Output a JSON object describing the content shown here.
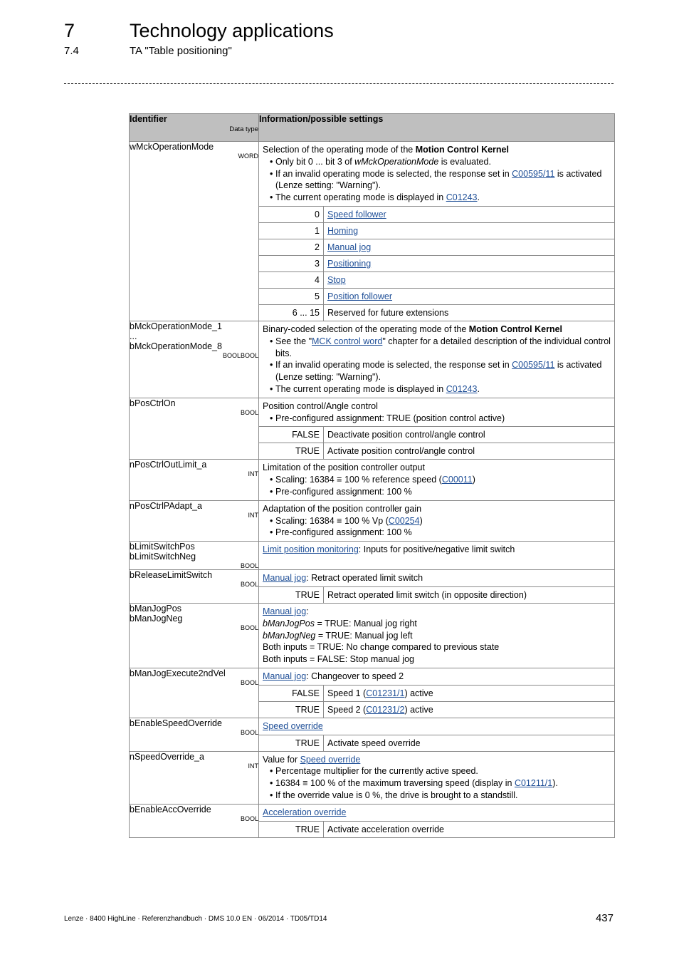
{
  "header": {
    "chapter_number": "7",
    "chapter_title": "Technology applications",
    "section_number": "7.4",
    "section_title": "TA \"Table positioning\""
  },
  "table": {
    "col_identifier": "Identifier",
    "col_datatype": "Data type",
    "col_info": "Information/possible settings",
    "rows": [
      {
        "id": "wMckOperationMode",
        "type": "WORD",
        "desc_pre": "Selection of the operating mode of the ",
        "desc_bold": "Motion Control Kernel",
        "b1_pre": "Only bit 0 ... bit 3 of ",
        "b1_ital": "wMckOperationMode",
        "b1_post": " is evaluated.",
        "b2_pre": "If an invalid operating mode is selected, the response set in ",
        "b2_link": "C00595/11",
        "b2_post": " is activated (Lenze setting: \"Warning\").",
        "b3_pre": "The current operating mode is displayed in ",
        "b3_link": "C01243",
        "b3_post": ".",
        "values": [
          {
            "v": "0",
            "t": "Speed follower"
          },
          {
            "v": "1",
            "t": "Homing"
          },
          {
            "v": "2",
            "t": "Manual jog"
          },
          {
            "v": "3",
            "t": "Positioning"
          },
          {
            "v": "4",
            "t": "Stop"
          },
          {
            "v": "5",
            "t": "Position follower"
          },
          {
            "v": "6 ... 15",
            "t": "Reserved for future extensions"
          }
        ]
      },
      {
        "id1": "bMckOperationMode_1",
        "id_dots": "...",
        "id2": "bMckOperationMode_8",
        "type": "BOOLBOOL",
        "desc_pre": "Binary-coded selection of the operating mode of the ",
        "desc_bold": "Motion Control Kernel",
        "b1_pre": "See the \"",
        "b1_link": "MCK control word",
        "b1_post": "\" chapter for a detailed description of the individual control bits.",
        "b2_pre": "If an invalid operating mode is selected, the response set in ",
        "b2_link": "C00595/11",
        "b2_post": " is activated (Lenze setting: \"Warning\").",
        "b3_pre": "The current operating mode is displayed in ",
        "b3_link": "C01243",
        "b3_post": "."
      },
      {
        "id": "bPosCtrlOn",
        "type": "BOOL",
        "desc": "Position control/Angle control",
        "b1": "Pre-configured assignment: TRUE (position control active)",
        "values": [
          {
            "v": "FALSE",
            "t": "Deactivate position control/angle control"
          },
          {
            "v": "TRUE",
            "t": "Activate position control/angle control"
          }
        ]
      },
      {
        "id": "nPosCtrlOutLimit_a",
        "type": "INT",
        "desc": "Limitation of the position controller output",
        "b1_pre": "Scaling: 16384 ≡ 100 % reference speed (",
        "b1_link": "C00011",
        "b1_post": ")",
        "b2": "Pre-configured assignment: 100 %"
      },
      {
        "id": "nPosCtrlPAdapt_a",
        "type": "INT",
        "desc": "Adaptation of the position controller gain",
        "b1_pre": "Scaling: 16384 ≡ 100 % Vp (",
        "b1_link": "C00254",
        "b1_post": ")",
        "b2": "Pre-configured assignment: 100 %"
      },
      {
        "id1": "bLimitSwitchPos",
        "id2": "bLimitSwitchNeg",
        "type": "BOOL",
        "desc_link": "Limit position monitoring",
        "desc_post": ": Inputs for positive/negative limit switch"
      },
      {
        "id": "bReleaseLimitSwitch",
        "type": "BOOL",
        "desc_link": "Manual jog",
        "desc_post": ": Retract operated limit switch",
        "values": [
          {
            "v": "TRUE",
            "t": "Retract operated limit switch (in opposite direction)"
          }
        ]
      },
      {
        "id1": "bManJogPos",
        "id2": "bManJogNeg",
        "type": "BOOL",
        "desc_link": "Manual jog",
        "desc_post": ":",
        "l1_ital": "bManJogPos",
        "l1_post": " = TRUE: Manual jog right",
        "l2_ital": "bManJogNeg",
        "l2_post": " = TRUE: Manual jog left",
        "l3": "Both inputs = TRUE: No change compared to previous state",
        "l4": "Both inputs = FALSE: Stop manual jog"
      },
      {
        "id": "bManJogExecute2ndVel",
        "type": "BOOL",
        "desc_link": "Manual jog",
        "desc_post": ": Changeover to speed 2",
        "values": [
          {
            "v": "FALSE",
            "t_pre": "Speed 1 (",
            "t_link": "C01231/1",
            "t_post": ") active"
          },
          {
            "v": "TRUE",
            "t_pre": "Speed 2 (",
            "t_link": "C01231/2",
            "t_post": ") active"
          }
        ]
      },
      {
        "id": "bEnableSpeedOverride",
        "type": "BOOL",
        "desc_link": "Speed override",
        "values": [
          {
            "v": "TRUE",
            "t": "Activate speed override"
          }
        ]
      },
      {
        "id": "nSpeedOverride_a",
        "type": "INT",
        "desc_pre": "Value for ",
        "desc_link": "Speed override",
        "b1": "Percentage multiplier for the currently active speed.",
        "b2_pre": "16384 ≡ 100 % of the maximum traversing speed (display in ",
        "b2_link": "C01211/1",
        "b2_post": ").",
        "b3": "If the override value is 0 %, the drive is brought to a standstill."
      },
      {
        "id": "bEnableAccOverride",
        "type": "BOOL",
        "desc_link": "Acceleration override",
        "values": [
          {
            "v": "TRUE",
            "t": "Activate acceleration override"
          }
        ]
      }
    ]
  },
  "footer": {
    "text": "Lenze · 8400 HighLine · Referenzhandbuch · DMS 10.0 EN · 06/2014 · TD05/TD14",
    "page": "437"
  }
}
